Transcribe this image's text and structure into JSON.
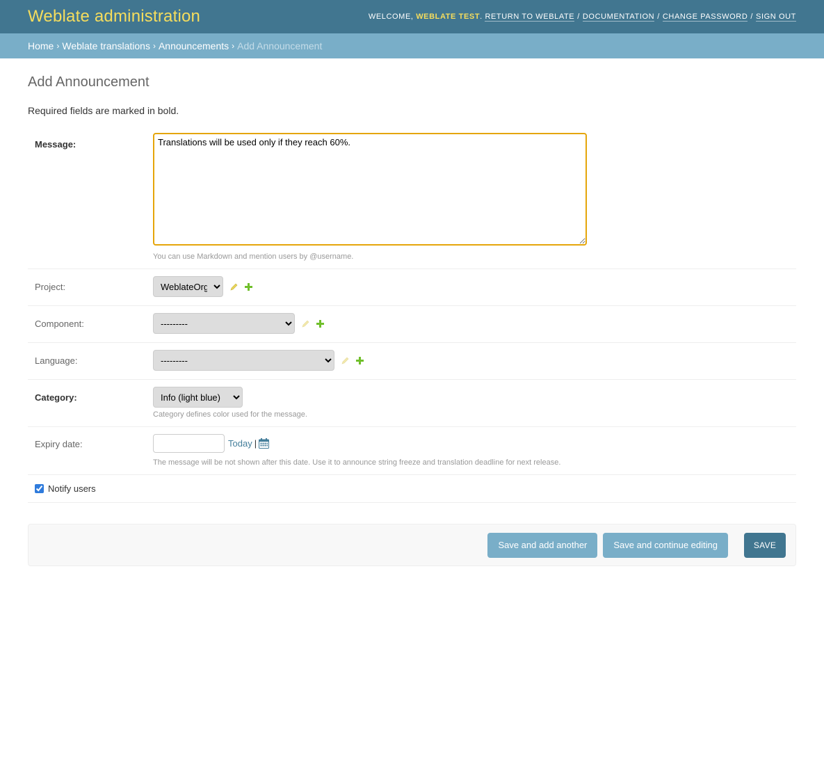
{
  "header": {
    "site_name": "Weblate administration",
    "welcome": "Welcome,",
    "username": "Weblate Test",
    "links": {
      "return": "Return to Weblate",
      "documentation": "Documentation",
      "change_password": "Change password",
      "sign_out": "Sign out"
    }
  },
  "breadcrumbs": {
    "home": "Home",
    "app": "Weblate translations",
    "model": "Announcements",
    "current": "Add Announcement",
    "separator": "›"
  },
  "page": {
    "title": "Add Announcement",
    "required_note": "Required fields are marked in bold."
  },
  "form": {
    "message": {
      "label": "Message:",
      "value": "Translations will be used only if they reach 60%.",
      "help": "You can use Markdown and mention users by @username."
    },
    "project": {
      "label": "Project:",
      "selected": "WeblateOrg"
    },
    "component": {
      "label": "Component:",
      "selected": "---------"
    },
    "language": {
      "label": "Language:",
      "selected": "---------"
    },
    "category": {
      "label": "Category:",
      "selected": "Info (light blue)",
      "help": "Category defines color used for the message."
    },
    "expiry": {
      "label": "Expiry date:",
      "value": "",
      "today": "Today",
      "separator": "|",
      "help": "The message will be not shown after this date. Use it to announce string freeze and translation deadline for next release."
    },
    "notify": {
      "label": "Notify users",
      "checked": true
    }
  },
  "buttons": {
    "save_add_another": "Save and add another",
    "save_continue": "Save and continue editing",
    "save": "Save"
  },
  "colors": {
    "header_bg": "#417690",
    "breadcrumbs_bg": "#79aec8",
    "brand_yellow": "#f5dd5d",
    "focus_border": "#e5a50a",
    "edit_icon": "#e8d55a",
    "add_icon": "#70bf2b"
  },
  "icons": {
    "edit": "pencil-icon",
    "add": "plus-icon",
    "calendar": "calendar-icon"
  }
}
